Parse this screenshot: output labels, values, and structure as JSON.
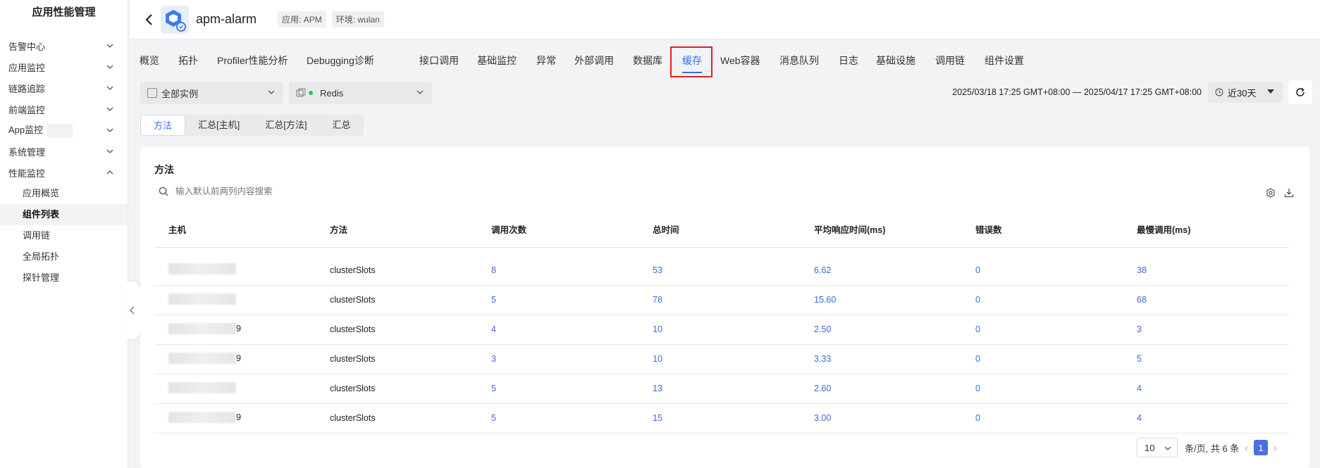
{
  "sidebar": {
    "title": "应用性能管理",
    "groups": [
      {
        "label": "告警中心"
      },
      {
        "label": "应用监控"
      },
      {
        "label": "链路追踪"
      },
      {
        "label": "前端监控"
      },
      {
        "label": "App监控"
      },
      {
        "label": "系统管理"
      },
      {
        "label": "性能监控"
      }
    ],
    "subitems": [
      {
        "label": "应用概览"
      },
      {
        "label": "组件列表"
      },
      {
        "label": "调用链"
      },
      {
        "label": "全局拓扑"
      },
      {
        "label": "探针管理"
      }
    ]
  },
  "header": {
    "app_name": "apm-alarm",
    "tag_app": "应用: APM",
    "tag_env": "环境: wulan"
  },
  "tabs": [
    "概览",
    "拓扑",
    "Profiler性能分析",
    "Debugging诊断",
    "接口调用",
    "基础监控",
    "异常",
    "外部调用",
    "数据库",
    "缓存",
    "Web容器",
    "消息队列",
    "日志",
    "基础设施",
    "调用链",
    "组件设置"
  ],
  "filters": {
    "instance": "全部实例",
    "component": "Redis",
    "date_range": "2025/03/18 17:25 GMT+08:00 — 2025/04/17 17:25 GMT+08:00",
    "quick_range": "近30天"
  },
  "subtabs": [
    "方法",
    "汇总[主机]",
    "汇总[方法]",
    "汇总"
  ],
  "card": {
    "title": "方法",
    "search_placeholder": "输入默认前两列内容搜索"
  },
  "table": {
    "headers": [
      "主机",
      "方法",
      "调用次数",
      "总时间",
      "平均响应时间(ms)",
      "错误数",
      "最慢调用(ms)"
    ],
    "rows": [
      {
        "host_suffix": "",
        "method": "clusterSlots",
        "calls": "8",
        "total": "53",
        "avg": "6.62",
        "errors": "0",
        "slowest": "38"
      },
      {
        "host_suffix": "",
        "method": "clusterSlots",
        "calls": "5",
        "total": "78",
        "avg": "15.60",
        "errors": "0",
        "slowest": "68"
      },
      {
        "host_suffix": "9",
        "method": "clusterSlots",
        "calls": "4",
        "total": "10",
        "avg": "2.50",
        "errors": "0",
        "slowest": "3"
      },
      {
        "host_suffix": "9",
        "method": "clusterSlots",
        "calls": "3",
        "total": "10",
        "avg": "3.33",
        "errors": "0",
        "slowest": "5"
      },
      {
        "host_suffix": "",
        "method": "clusterSlots",
        "calls": "5",
        "total": "13",
        "avg": "2.60",
        "errors": "0",
        "slowest": "4"
      },
      {
        "host_suffix": "9",
        "method": "clusterSlots",
        "calls": "5",
        "total": "15",
        "avg": "3.00",
        "errors": "0",
        "slowest": "4"
      }
    ]
  },
  "pager": {
    "page_size": "10",
    "summary": "条/页, 共 6 条",
    "current": "1"
  },
  "colors": {
    "accent": "#3370ff",
    "link": "#3f6ad8",
    "highlight": "#e02020"
  }
}
